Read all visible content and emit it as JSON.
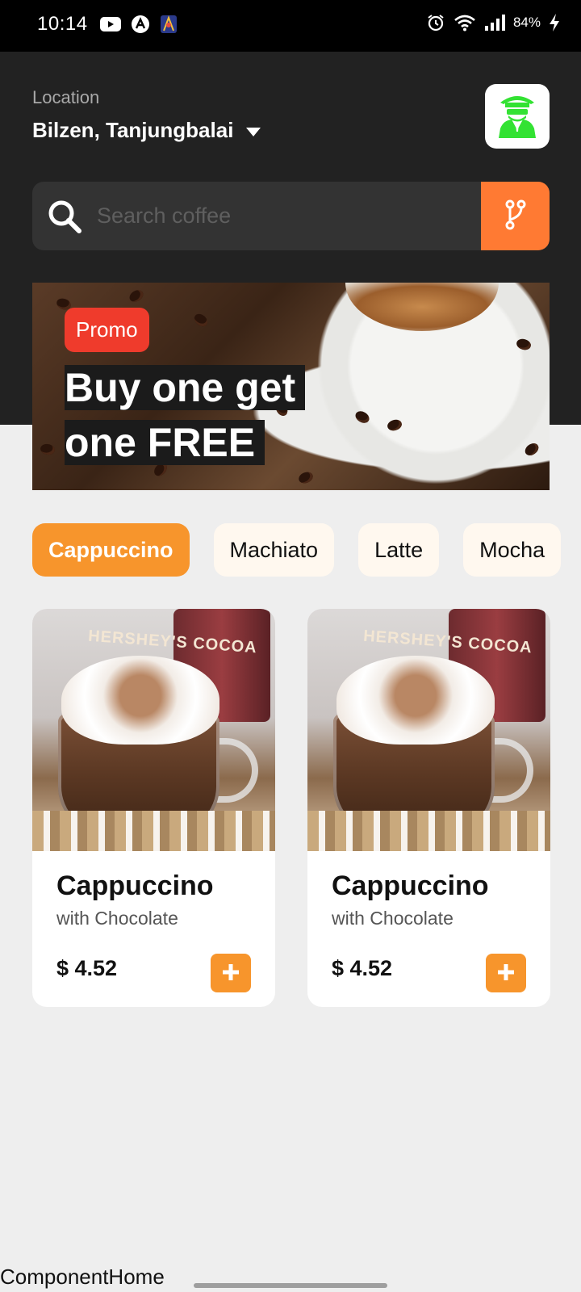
{
  "status_bar": {
    "time": "10:14",
    "battery": "84%"
  },
  "location": {
    "label": "Location",
    "value": "Bilzen, Tanjungbalai"
  },
  "search": {
    "placeholder": "Search coffee",
    "value": ""
  },
  "promo": {
    "badge": "Promo",
    "title": "Buy one get one FREE"
  },
  "categories": [
    {
      "label": "Cappuccino",
      "active": true
    },
    {
      "label": "Machiato",
      "active": false
    },
    {
      "label": "Latte",
      "active": false
    },
    {
      "label": "Mocha",
      "active": false
    }
  ],
  "products": [
    {
      "name": "Cappuccino",
      "subtitle": "with Chocolate",
      "price": "$ 4.52",
      "tin_label": "HERSHEY'S COCOA"
    },
    {
      "name": "Cappuccino",
      "subtitle": "with Chocolate",
      "price": "$ 4.52",
      "tin_label": "HERSHEY'S COCOA"
    }
  ],
  "debug_label": "ComponentHome",
  "colors": {
    "accent": "#F7952C",
    "filter": "#FF7A33",
    "promo_badge": "#EF3B2C",
    "header_bg": "#222222",
    "avatar_icon": "#33E233"
  }
}
